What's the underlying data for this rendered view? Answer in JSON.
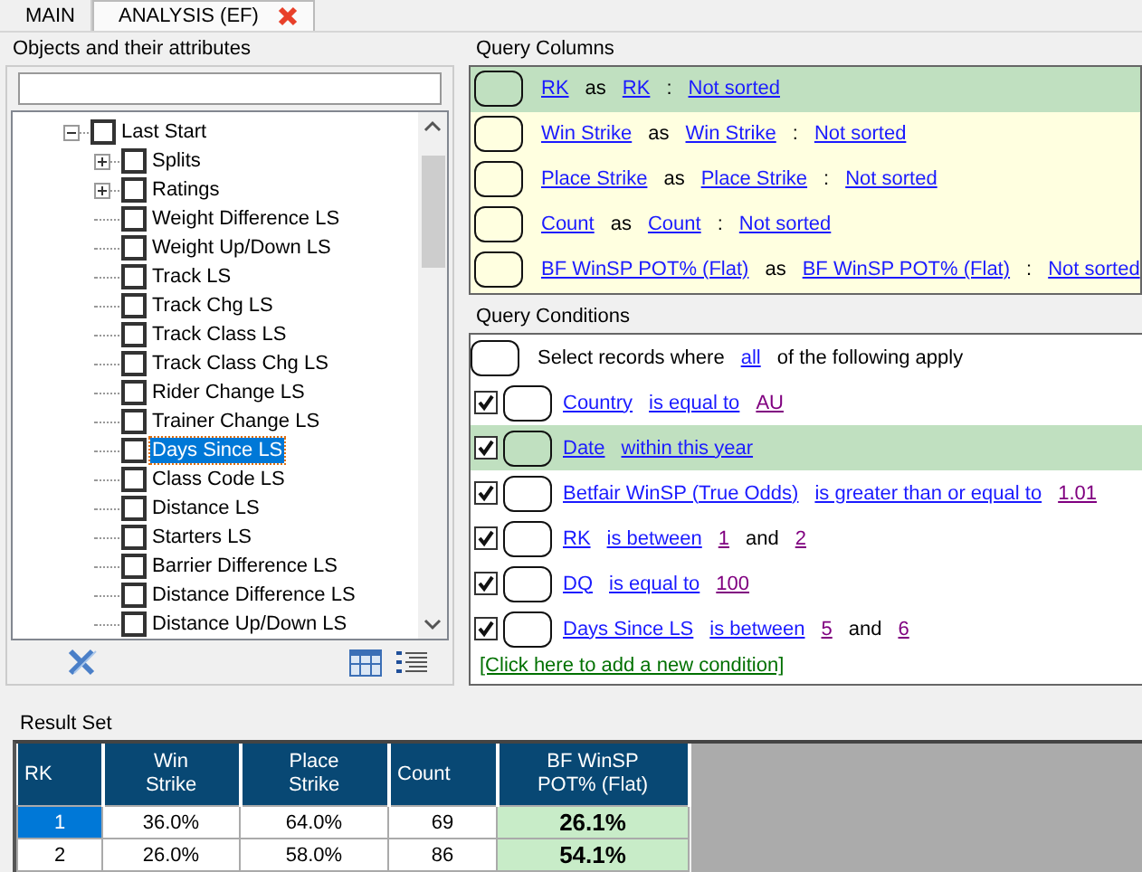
{
  "tabs": [
    {
      "label": "MAIN",
      "selected": false,
      "closable": false
    },
    {
      "label": "ANALYSIS (EF)",
      "selected": true,
      "closable": true
    }
  ],
  "objects": {
    "title": "Objects and their attributes",
    "tree": [
      {
        "label": "Last Start",
        "kind": "group",
        "expanded": true,
        "checked": false,
        "selected": false,
        "children": [
          {
            "label": "Splits",
            "kind": "group",
            "expanded": false,
            "checked": false,
            "selected": false
          },
          {
            "label": "Ratings",
            "kind": "group",
            "expanded": false,
            "checked": false,
            "selected": false
          },
          {
            "label": "Weight Difference LS",
            "kind": "leaf",
            "checked": false,
            "selected": false
          },
          {
            "label": "Weight Up/Down LS",
            "kind": "leaf",
            "checked": false,
            "selected": false
          },
          {
            "label": "Track LS",
            "kind": "leaf",
            "checked": false,
            "selected": false
          },
          {
            "label": "Track Chg LS",
            "kind": "leaf",
            "checked": false,
            "selected": false
          },
          {
            "label": "Track Class LS",
            "kind": "leaf",
            "checked": false,
            "selected": false
          },
          {
            "label": "Track Class Chg LS",
            "kind": "leaf",
            "checked": false,
            "selected": false
          },
          {
            "label": "Rider Change LS",
            "kind": "leaf",
            "checked": false,
            "selected": false
          },
          {
            "label": "Trainer Change LS",
            "kind": "leaf",
            "checked": false,
            "selected": false
          },
          {
            "label": "Days Since LS",
            "kind": "leaf",
            "checked": false,
            "selected": true
          },
          {
            "label": "Class Code LS",
            "kind": "leaf",
            "checked": false,
            "selected": false
          },
          {
            "label": "Distance LS",
            "kind": "leaf",
            "checked": false,
            "selected": false
          },
          {
            "label": "Starters LS",
            "kind": "leaf",
            "checked": false,
            "selected": false
          },
          {
            "label": "Barrier Difference LS",
            "kind": "leaf",
            "checked": false,
            "selected": false
          },
          {
            "label": "Distance Difference LS",
            "kind": "leaf",
            "checked": false,
            "selected": false
          },
          {
            "label": "Distance Up/Down LS",
            "kind": "leaf",
            "checked": false,
            "selected": false
          }
        ]
      }
    ]
  },
  "query_columns": {
    "title": "Query Columns",
    "rows": [
      {
        "source": "RK",
        "as": "as",
        "alias": "RK",
        "sep": ":",
        "sort": "Not sorted",
        "selected": true
      },
      {
        "source": "Win Strike",
        "as": "as",
        "alias": "Win Strike",
        "sep": ":",
        "sort": "Not sorted",
        "selected": false
      },
      {
        "source": "Place Strike",
        "as": "as",
        "alias": "Place Strike",
        "sep": ":",
        "sort": "Not sorted",
        "selected": false
      },
      {
        "source": "Count",
        "as": "as",
        "alias": "Count",
        "sep": ":",
        "sort": "Not sorted",
        "selected": false
      },
      {
        "source": "BF WinSP POT% (Flat)",
        "as": "as",
        "alias": "BF WinSP POT% (Flat)",
        "sep": ":",
        "sort": "Not sorted",
        "selected": false
      }
    ]
  },
  "query_conditions": {
    "title": "Query Conditions",
    "header": [
      {
        "kind": "text",
        "text": "Select records where"
      },
      {
        "kind": "link",
        "text": "all"
      },
      {
        "kind": "text",
        "text": "of the following apply"
      }
    ],
    "rows": [
      {
        "checked": true,
        "selected": false,
        "parts": [
          {
            "kind": "link",
            "text": "Country"
          },
          {
            "kind": "link",
            "text": "is equal to"
          },
          {
            "kind": "value",
            "text": "AU"
          }
        ]
      },
      {
        "checked": true,
        "selected": true,
        "parts": [
          {
            "kind": "link",
            "text": "Date"
          },
          {
            "kind": "link",
            "text": "within this year"
          }
        ]
      },
      {
        "checked": true,
        "selected": false,
        "parts": [
          {
            "kind": "link",
            "text": "Betfair WinSP (True Odds)"
          },
          {
            "kind": "link",
            "text": "is greater than or equal to"
          },
          {
            "kind": "value",
            "text": "1.01"
          }
        ]
      },
      {
        "checked": true,
        "selected": false,
        "parts": [
          {
            "kind": "link",
            "text": "RK"
          },
          {
            "kind": "link",
            "text": "is between"
          },
          {
            "kind": "value",
            "text": "1"
          },
          {
            "kind": "text",
            "text": "and"
          },
          {
            "kind": "value",
            "text": "2"
          }
        ]
      },
      {
        "checked": true,
        "selected": false,
        "parts": [
          {
            "kind": "link",
            "text": "DQ"
          },
          {
            "kind": "link",
            "text": "is equal to"
          },
          {
            "kind": "value",
            "text": "100"
          }
        ]
      },
      {
        "checked": true,
        "selected": false,
        "parts": [
          {
            "kind": "link",
            "text": "Days Since LS"
          },
          {
            "kind": "link",
            "text": "is between"
          },
          {
            "kind": "value",
            "text": "5"
          },
          {
            "kind": "text",
            "text": "and"
          },
          {
            "kind": "value",
            "text": "6"
          }
        ]
      }
    ],
    "add_condition": "[Click here to add a new condition]"
  },
  "result_set": {
    "title": "Result Set",
    "columns": [
      {
        "label": "RK",
        "kind": "key"
      },
      {
        "label": "Win Strike",
        "kind": "plain"
      },
      {
        "label": "Place Strike",
        "kind": "plain"
      },
      {
        "label": "Count",
        "kind": "plain"
      },
      {
        "label": "BF WinSP POT% (Flat)",
        "kind": "highlight"
      }
    ],
    "rows": [
      {
        "selected": true,
        "cells": [
          "1",
          "36.0%",
          "64.0%",
          "69",
          "26.1%"
        ]
      },
      {
        "selected": false,
        "cells": [
          "2",
          "26.0%",
          "58.0%",
          "86",
          "54.1%"
        ]
      }
    ]
  }
}
